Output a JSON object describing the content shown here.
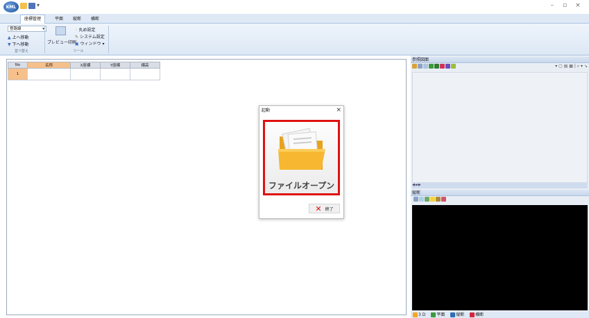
{
  "app": {
    "logo": "KML"
  },
  "window": {
    "minimize": "–",
    "restore": "▫",
    "close": "×"
  },
  "tabs": [
    {
      "label": "座標管理",
      "active": true
    },
    {
      "label": "平面"
    },
    {
      "label": "縦断"
    },
    {
      "label": "横断"
    }
  ],
  "ribbon": {
    "route_combo": "登路線",
    "move_up": "上へ移動",
    "move_down": "下へ移動",
    "group_sort": "並べ替え",
    "preview": "プレビュー印刷",
    "circle_settings": "丸め設定",
    "system_settings": "システム設定",
    "window_menu": "ウィンドウ",
    "group_tools": "ツール"
  },
  "table": {
    "headers": [
      "No",
      "名称",
      "X座標",
      "Y座標",
      "標高"
    ],
    "rows": [
      [
        "1",
        "",
        "",
        "",
        ""
      ]
    ]
  },
  "panels": {
    "reference": "参照図面",
    "profile": "縦断"
  },
  "dialog": {
    "title": "起動",
    "open_label": "ファイルオープン",
    "end_label": "終了"
  },
  "bottom_tabs": [
    "3 D",
    "平面",
    "縦断",
    "横断"
  ],
  "colors": {
    "accent_red": "#e01010",
    "ribbon_blue": "#dfe9f6",
    "folder": "#f7b731"
  }
}
